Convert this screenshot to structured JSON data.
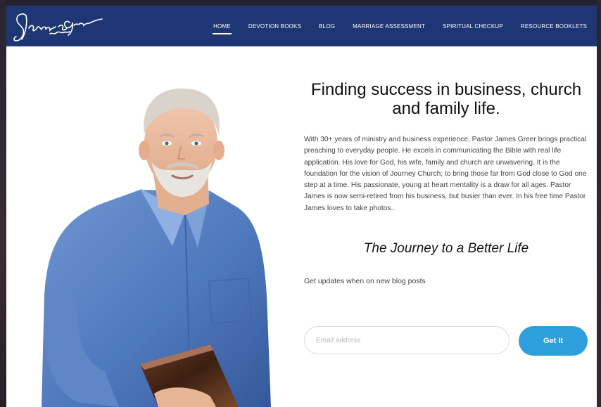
{
  "header": {
    "logo_signature": "James Greer",
    "nav": [
      {
        "label": "HOME",
        "active": true
      },
      {
        "label": "DEVOTION BOOKS"
      },
      {
        "label": "BLOG"
      },
      {
        "label": "MARRIAGE ASSESSMENT"
      },
      {
        "label": "SPIRITUAL CHECKUP"
      },
      {
        "label": "RESOURCE BOOKLETS"
      }
    ]
  },
  "hero": {
    "headline": "Finding success in business, church and family life.",
    "bio": "With 30+ years of ministry and business experience, Pastor James Greer brings practical preaching to everyday people. He excels in communicating the Bible with real life application. His love for God, his wife, family and church are unwavering. It is the foundation for the vision of Journey Church; to bring those far from God close to God one step at a time. His passionate, young at heart mentality is a draw for all ages. Pastor James is now semi-retired from his business, but busier than ever. In his free time Pastor James loves to take photos..",
    "tagline": "The Journey to a Better Life"
  },
  "subscribe": {
    "prompt": "Get updates when on new blog posts",
    "email_placeholder": "Email address",
    "email_value": "",
    "button_label": "Get It"
  },
  "colors": {
    "navbar": "#1e3774",
    "accent_button": "#2f9fdc",
    "shirt": "#4f79bd"
  }
}
